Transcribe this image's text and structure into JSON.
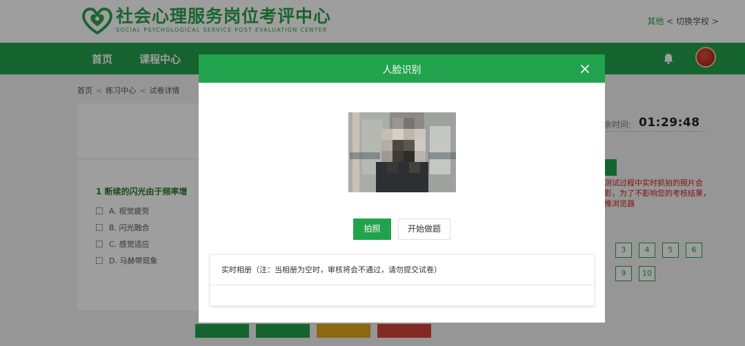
{
  "header": {
    "logo_cn": "社会心理服务岗位考评中心",
    "logo_en": "SOCIAL PSYCHOLOGICAL SERVICE POST EVALUATION CENTER",
    "other_label": "其他",
    "switch_label": "< 切换学校 >"
  },
  "nav": {
    "items": [
      {
        "label": "首页"
      },
      {
        "label": "课程中心"
      }
    ]
  },
  "breadcrumb": {
    "items": [
      "首页",
      "练习中心",
      "试卷详情"
    ],
    "separator": "<"
  },
  "question": {
    "title": "1 断续的闪光由于频率增",
    "options": [
      "A. 视觉疲劳",
      "B. 闪光融合",
      "C. 感觉适应",
      "D. 马赫带现象"
    ]
  },
  "sidebar": {
    "timer_label": "余时间:",
    "timer_value": "01:29:48",
    "warning": "测试过程中实时抓拍的照片会影，为了不影响您的考核结果，推浏览器",
    "question_numbers": [
      "3",
      "4",
      "5",
      "6",
      "9",
      "10"
    ]
  },
  "modal": {
    "title": "人脸识别",
    "photo_button": "拍照",
    "start_button": "开始做题",
    "album_label": "实时相册（注：当相册为空时，审核将会不通过，请勿提交试卷）"
  },
  "colors": {
    "brand_green": "#23a24d",
    "warning_red": "#d21e1e"
  }
}
